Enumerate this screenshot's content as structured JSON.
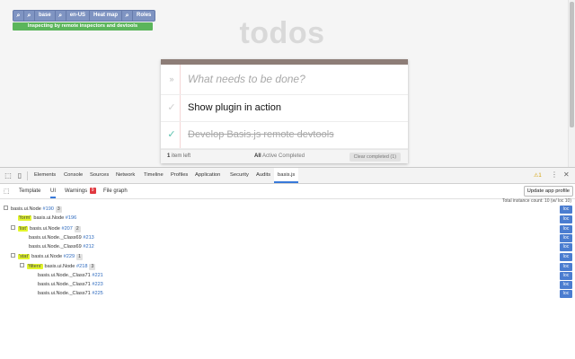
{
  "app": {
    "title": "todos",
    "basis_bar": {
      "base_label": "base",
      "locale_label": "en-US",
      "heatmap_label": "Heat map",
      "roles_label": "Roles"
    },
    "inspect_banner": "Inspecting by remote inspectors and devtools",
    "new_todo_placeholder": "What needs to be done?",
    "todos": [
      {
        "label": "Show plugin in action",
        "completed": false
      },
      {
        "label": "Develop Basis.js remote devtools",
        "completed": true
      }
    ],
    "footer": {
      "count_number": "1",
      "count_text": "item left",
      "filter_all": "All",
      "filter_active": "Active",
      "filter_completed": "Completed",
      "clear_label": "Clear completed (1)"
    }
  },
  "devtools": {
    "tabs": [
      "Elements",
      "Console",
      "Sources",
      "Network",
      "Timeline",
      "Profiles",
      "Application",
      "Security",
      "Audits",
      "basis.js"
    ],
    "active_tab": "basis.js",
    "warning_count": "1",
    "panel_tabs": [
      "Template",
      "UI",
      "Warnings",
      "File graph"
    ],
    "active_panel_tab": "UI",
    "warnings_badge": "9",
    "update_button": "Update app profile",
    "instance_count": "Total instance count: 10 (w/ loc 10)",
    "loc_label": "loc",
    "tree": [
      {
        "node": "basis.ui.Node",
        "id": "#190",
        "count": "3",
        "role": ""
      },
      {
        "node": "basis.ui.Node",
        "id": "#196",
        "count": "",
        "role": "'form'"
      },
      {
        "node": "basis.ui.Node",
        "id": "#207",
        "count": "2",
        "role": "'list'"
      },
      {
        "node": "basis.ui.Node._Class69",
        "id": "#213",
        "count": "",
        "role": ""
      },
      {
        "node": "basis.ui.Node._Class69",
        "id": "#212",
        "count": "",
        "role": ""
      },
      {
        "node": "basis.ui.Node",
        "id": "#229",
        "count": "1",
        "role": "'stat'"
      },
      {
        "node": "basis.ui.Node",
        "id": "#218",
        "count": "3",
        "role": "'filters'"
      },
      {
        "node": "basis.ui.Node._Class71",
        "id": "#221",
        "count": "",
        "role": ""
      },
      {
        "node": "basis.ui.Node._Class71",
        "id": "#223",
        "count": "",
        "role": ""
      },
      {
        "node": "basis.ui.Node._Class71",
        "id": "#225",
        "count": "",
        "role": ""
      }
    ]
  }
}
